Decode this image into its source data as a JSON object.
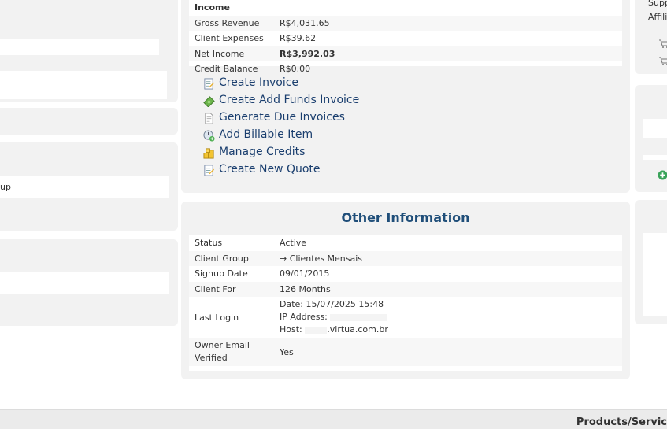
{
  "income": {
    "heading": "Income",
    "rows": [
      {
        "label": "Gross Revenue",
        "value": "R$4,031.65"
      },
      {
        "label": "Client Expenses",
        "value": "R$39.62"
      },
      {
        "label": "Net Income",
        "value": "R$3,992.03"
      },
      {
        "label": "Credit Balance",
        "value": "R$0.00"
      }
    ]
  },
  "actions": [
    {
      "label": "Create Invoice",
      "icon": "invoice-icon"
    },
    {
      "label": "Create Add Funds Invoice",
      "icon": "money-icon"
    },
    {
      "label": "Generate Due Invoices",
      "icon": "document-icon"
    },
    {
      "label": "Add Billable Item",
      "icon": "clock-add-icon"
    },
    {
      "label": "Manage Credits",
      "icon": "coins-icon"
    },
    {
      "label": "Create New Quote",
      "icon": "quote-icon"
    }
  ],
  "other_info": {
    "title": "Other Information",
    "rows": [
      {
        "label": "Status",
        "value": "Active"
      },
      {
        "label": "Client Group",
        "value": "→ Clientes Mensais"
      },
      {
        "label": "Signup Date",
        "value": "09/01/2015"
      },
      {
        "label": "Client For",
        "value": "126 Months"
      }
    ],
    "last_login": {
      "label": "Last Login",
      "date": "Date: 15/07/2025 15:48",
      "ip": "IP Address: ",
      "host_prefix": "Host: ",
      "host_suffix": ".virtua.com.br"
    },
    "owner_email": {
      "label_line1": "Owner Email",
      "label_line2": "Verified",
      "value": "Yes"
    }
  },
  "left_column": {
    "group_snippet": "up"
  },
  "right_column": {
    "support_snippet": "Supp",
    "affiliate_snippet": "Affili"
  },
  "footer": {
    "label": "Products/Servic"
  }
}
